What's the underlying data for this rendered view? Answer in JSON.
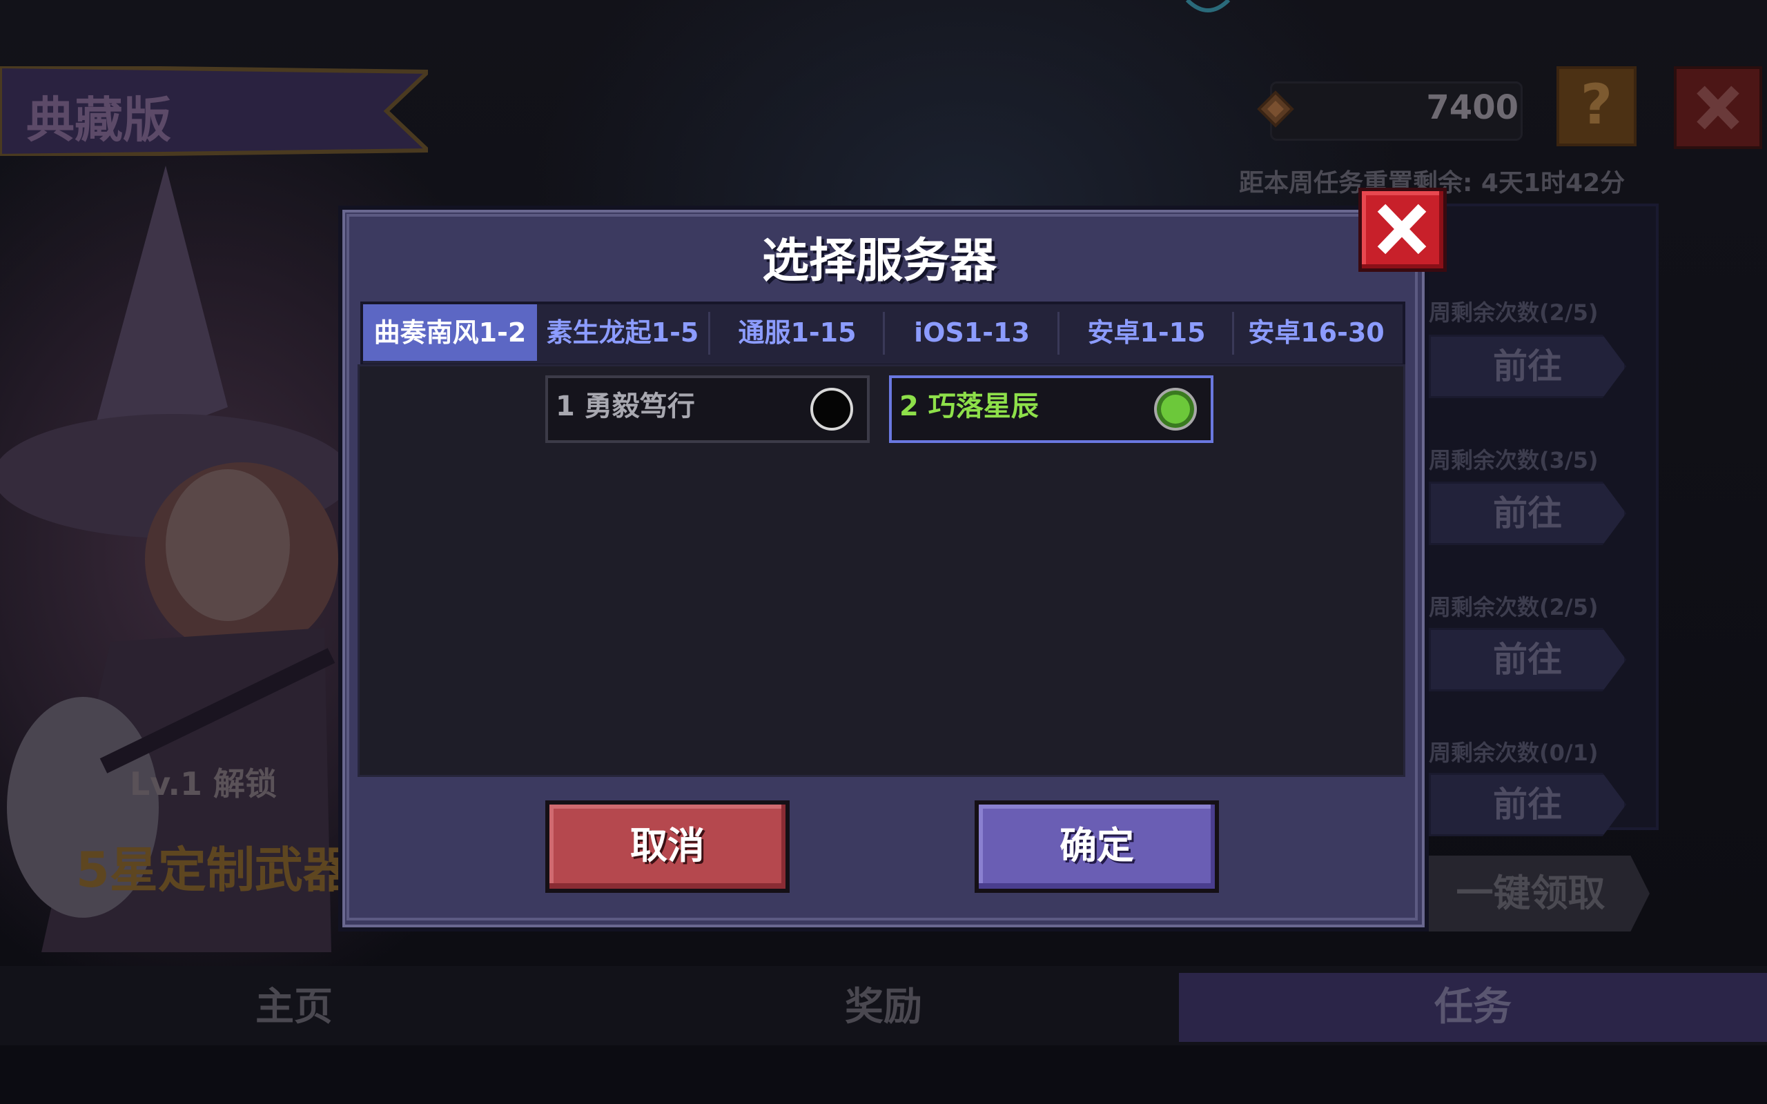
{
  "background": {
    "banner_title": "典藏版",
    "unlock_level": "Lv.1 解锁",
    "weapon_text": "5星定制武器",
    "currency": {
      "value": "7400",
      "icon": "gem-icon"
    },
    "help_label": "?",
    "timer": "距本周任务重置剩余: 4天1时42分",
    "tasks": [
      {
        "count": "周剩余次数(2/5)",
        "go": "前往"
      },
      {
        "count": "周剩余次数(3/5)",
        "go": "前往"
      },
      {
        "count": "周剩余次数(2/5)",
        "go": "前往"
      },
      {
        "count": "周剩余次数(0/1)",
        "go": "前往"
      }
    ],
    "claim_all": "一键领取",
    "bottom_tabs": {
      "home": "主页",
      "reward": "奖励",
      "task": "任务"
    }
  },
  "modal": {
    "title": "选择服务器",
    "tabs": [
      "曲奏南风1-2",
      "素生龙起1-5",
      "通服1-15",
      "iOS1-13",
      "安卓1-15",
      "安卓16-30"
    ],
    "selected_tab": 0,
    "servers": [
      {
        "label": "1 勇毅笃行",
        "selected": false
      },
      {
        "label": "2 巧落星辰",
        "selected": true
      }
    ],
    "cancel_label": "取消",
    "confirm_label": "确定"
  },
  "colors": {
    "modal_bg": "#3c3a60",
    "tab_selected": "#5c67c4",
    "tab_text": "#8c9cff",
    "selected_server_text": "#8ee04a",
    "cancel": "#b5484e",
    "confirm": "#6a5eb4",
    "close_red": "#c8202a"
  }
}
